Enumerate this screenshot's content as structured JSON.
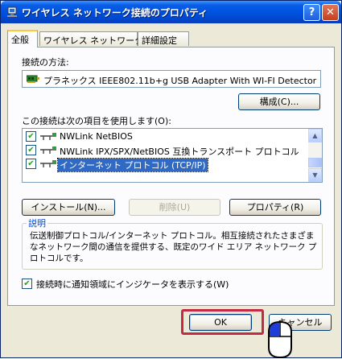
{
  "window": {
    "title": "ワイヤレス ネットワーク接続のプロパティ",
    "help_glyph": "?",
    "close_glyph": "✕"
  },
  "tabs": [
    {
      "label": "全般",
      "active": true
    },
    {
      "label": "ワイヤレス ネットワーク",
      "active": false
    },
    {
      "label": "詳細設定",
      "active": false
    }
  ],
  "general": {
    "connect_using_label": "接続の方法:",
    "adapter_icon": "network-adapter-icon",
    "adapter_name": "プラネックス IEEE802.11b+g USB Adapter With WI-FI Detector",
    "configure_button": "構成(C)...",
    "items_label": "この接続は次の項目を使用します(O):",
    "items": [
      {
        "label": "NWLink NetBIOS",
        "checked": true,
        "selected": false,
        "icon": "protocol-icon"
      },
      {
        "label": "NWLink IPX/SPX/NetBIOS 互換トランスポート プロトコル",
        "checked": true,
        "selected": false,
        "icon": "protocol-icon"
      },
      {
        "label": "インターネット プロトコル (TCP/IP)",
        "checked": true,
        "selected": true,
        "icon": "protocol-icon"
      }
    ],
    "install_button": "インストール(N)...",
    "uninstall_button": "削除(U)",
    "properties_button": "プロパティ(R)",
    "description_title": "説明",
    "description_text": "伝送制御プロトコル/インターネット プロトコル。相互接続されたさまざまなネットワーク間の通信を提供する、既定のワイド エリア ネットワーク プロトコルです。",
    "show_icon_label": "接続時に通知領域にインジケータを表示する(W)",
    "show_icon_checked": true
  },
  "footer": {
    "ok_button": "OK",
    "cancel_button": "キャンセル"
  },
  "colors": {
    "highlight_box": "#c22a45",
    "selection": "#316ac5",
    "titlebar": "#0054e3"
  }
}
